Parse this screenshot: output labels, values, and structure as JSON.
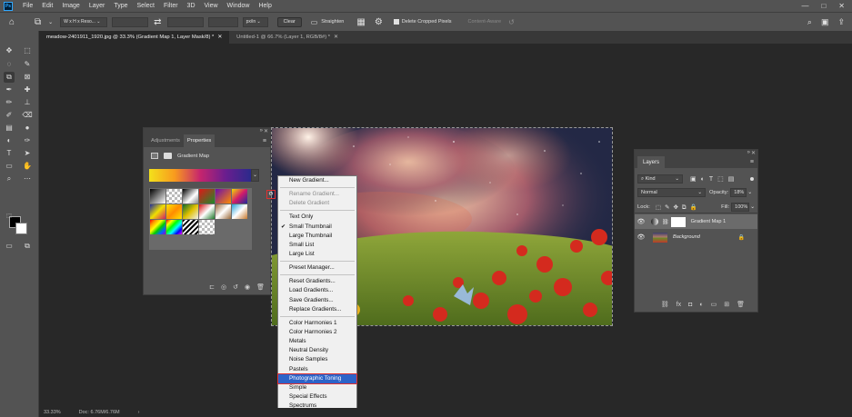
{
  "app": {
    "logo": "Ps"
  },
  "menu": [
    "File",
    "Edit",
    "Image",
    "Layer",
    "Type",
    "Select",
    "Filter",
    "3D",
    "View",
    "Window",
    "Help"
  ],
  "window_controls": [
    "—",
    "□",
    "✕"
  ],
  "options_bar": {
    "ratio_select": "W x H x Reso... ⌄",
    "units_select": "px/in ⌄",
    "clear_label": "Clear",
    "straighten_label": "Straighten",
    "delete_cropped_label": "Delete Cropped Pixels",
    "content_aware_label": "Content-Aware"
  },
  "doc_tabs": [
    {
      "label": "meadow-2401911_1920.jpg @ 33.3% (Gradient Map 1, Layer Mask/8) *",
      "close": "✕"
    },
    {
      "label": "Untitled-1 @ 66.7% (Layer 1, RGB/8#) *",
      "close": "✕"
    }
  ],
  "status": {
    "zoom": "33.33%",
    "doc": "Doc: 6.76M/6.76M",
    "arrow": "›"
  },
  "properties": {
    "tab_adjustments": "Adjustments",
    "tab_properties": "Properties",
    "title": "Gradient Map",
    "swatches": [
      "linear-gradient(135deg,#000,#fff)",
      "repeating-conic-gradient(#fff 0 25%,#bbb 0 50%) 0 0/6px 6px",
      "linear-gradient(135deg,#000 0%,#fff 60%,#888 100%)",
      "linear-gradient(135deg,#e01818,#1c8a2a)",
      "linear-gradient(135deg,#6a0dad,#ff8c00)",
      "linear-gradient(135deg,#f0e000,#d21b6a,#1e2b9c)",
      "linear-gradient(135deg,#1e2b9c,#f0e000,#d21b6a)",
      "linear-gradient(135deg,#ffe600,#ff8c00,#ffe600)",
      "linear-gradient(135deg,#0b6b2b,#e0c000,#f0f0f0)",
      "linear-gradient(135deg,#d61010,#fff,#1f7a2a)",
      "linear-gradient(135deg,#9b6a3a,#fff,#9b6a3a)",
      "linear-gradient(135deg,#28a0d8,#fff,#c77a2e)",
      "linear-gradient(135deg,#ff0000,#ff9900,#ffff00,#00cc00,#0066ff,#9900cc)",
      "linear-gradient(135deg,#ff0000,#ffff00,#00ff00,#00ffff,#0000ff,#ff00ff)",
      "repeating-linear-gradient(135deg,#000 0 2px,#fff 2px 4px)",
      "repeating-conic-gradient(#fff 0 25%,#bbb 0 50%) 0 0/6px 6px"
    ]
  },
  "gradient_menu": {
    "items": [
      {
        "label": "New Gradient...",
        "state": "normal"
      },
      {
        "sep": true
      },
      {
        "label": "Rename Gradient...",
        "state": "disabled"
      },
      {
        "label": "Delete Gradient",
        "state": "disabled"
      },
      {
        "sep": true
      },
      {
        "label": "Text Only",
        "state": "normal"
      },
      {
        "label": "Small Thumbnail",
        "state": "checked"
      },
      {
        "label": "Large Thumbnail",
        "state": "normal"
      },
      {
        "label": "Small List",
        "state": "normal"
      },
      {
        "label": "Large List",
        "state": "normal"
      },
      {
        "sep": true
      },
      {
        "label": "Preset Manager...",
        "state": "normal"
      },
      {
        "sep": true
      },
      {
        "label": "Reset Gradients...",
        "state": "normal"
      },
      {
        "label": "Load Gradients...",
        "state": "normal"
      },
      {
        "label": "Save Gradients...",
        "state": "normal"
      },
      {
        "label": "Replace Gradients...",
        "state": "normal"
      },
      {
        "sep": true
      },
      {
        "label": "Color Harmonies 1",
        "state": "normal"
      },
      {
        "label": "Color Harmonies 2",
        "state": "normal"
      },
      {
        "label": "Metals",
        "state": "normal"
      },
      {
        "label": "Neutral Density",
        "state": "normal"
      },
      {
        "label": "Noise Samples",
        "state": "normal"
      },
      {
        "label": "Pastels",
        "state": "normal"
      },
      {
        "label": "Photographic Toning",
        "state": "highlighted"
      },
      {
        "label": "Simple",
        "state": "normal"
      },
      {
        "label": "Special Effects",
        "state": "normal"
      },
      {
        "label": "Spectrums",
        "state": "normal"
      }
    ]
  },
  "layers": {
    "tab": "Layers",
    "filter_kind": "Kind",
    "blend_mode": "Normal",
    "opacity_label": "Opacity:",
    "opacity_value": "18%",
    "lock_label": "Lock:",
    "fill_label": "Fill:",
    "fill_value": "100%",
    "items": [
      {
        "name": "Gradient Map 1",
        "selected": true
      },
      {
        "name": "Background",
        "selected": false,
        "lock": "🔒"
      }
    ]
  }
}
